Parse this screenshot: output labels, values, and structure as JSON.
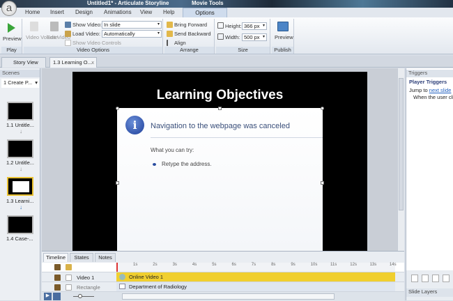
{
  "window": {
    "title": "Untitled1* - Articulate Storyline",
    "context_tab": "Movie Tools",
    "logo": "a"
  },
  "ribbon_tabs": [
    "Home",
    "Insert",
    "Design",
    "Animations",
    "View",
    "Help"
  ],
  "active_tab": "Options",
  "play": {
    "preview": "Preview",
    "group": "Play"
  },
  "video_options": {
    "video_volume": "Video Volume",
    "edit_video": "Edit Video",
    "show_video_label": "Show Video:",
    "show_video_value": "In slide",
    "load_video_label": "Load Video:",
    "load_video_value": "Automatically",
    "show_controls": "Show Video Controls",
    "group": "Video Options"
  },
  "arrange": {
    "bring_forward": "Bring Forward",
    "send_backward": "Send Backward",
    "align": "Align",
    "group": "Arrange"
  },
  "size": {
    "height_label": "Height:",
    "height_value": "366 px",
    "width_label": "Width:",
    "width_value": "500 px",
    "group": "Size"
  },
  "publish": {
    "preview": "Preview",
    "group": "Publish"
  },
  "doc_tabs": {
    "story_view": "Story View",
    "current": "1.3 Learning O...",
    "close": "x"
  },
  "scenes": {
    "header": "Scenes",
    "selected": "1 Create P...",
    "slides": [
      "1.1 Untitle...",
      "1.2 Untitle...",
      "1.3 Learni...",
      "1.4 Case-..."
    ]
  },
  "slide": {
    "title": "Learning Objectives",
    "dialog_heading": "Navigation to the webpage was canceled",
    "dialog_sub": "What you can try:",
    "dialog_bullet": "Retype the address."
  },
  "triggers": {
    "header": "Triggers",
    "section": "Player Triggers",
    "jump": "Jump to",
    "link": "next slide",
    "when": "When the user clicks"
  },
  "timeline": {
    "tabs": [
      "Timeline",
      "States",
      "Notes"
    ],
    "ticks": [
      "1s",
      "2s",
      "3s",
      "4s",
      "5s",
      "6s",
      "7s",
      "8s",
      "9s",
      "10s",
      "11s",
      "12s",
      "13s",
      "14s"
    ],
    "rows": [
      {
        "name": "Video 1",
        "bar": "Online Video 1"
      },
      {
        "name": "Rectangle",
        "bar": "Department of Radiology"
      }
    ]
  },
  "slide_layers": "Slide Layers",
  "colors": {
    "accent_yellow": "#f0cf2f",
    "link": "#1f5fbf",
    "heading": "#2c3e78"
  }
}
